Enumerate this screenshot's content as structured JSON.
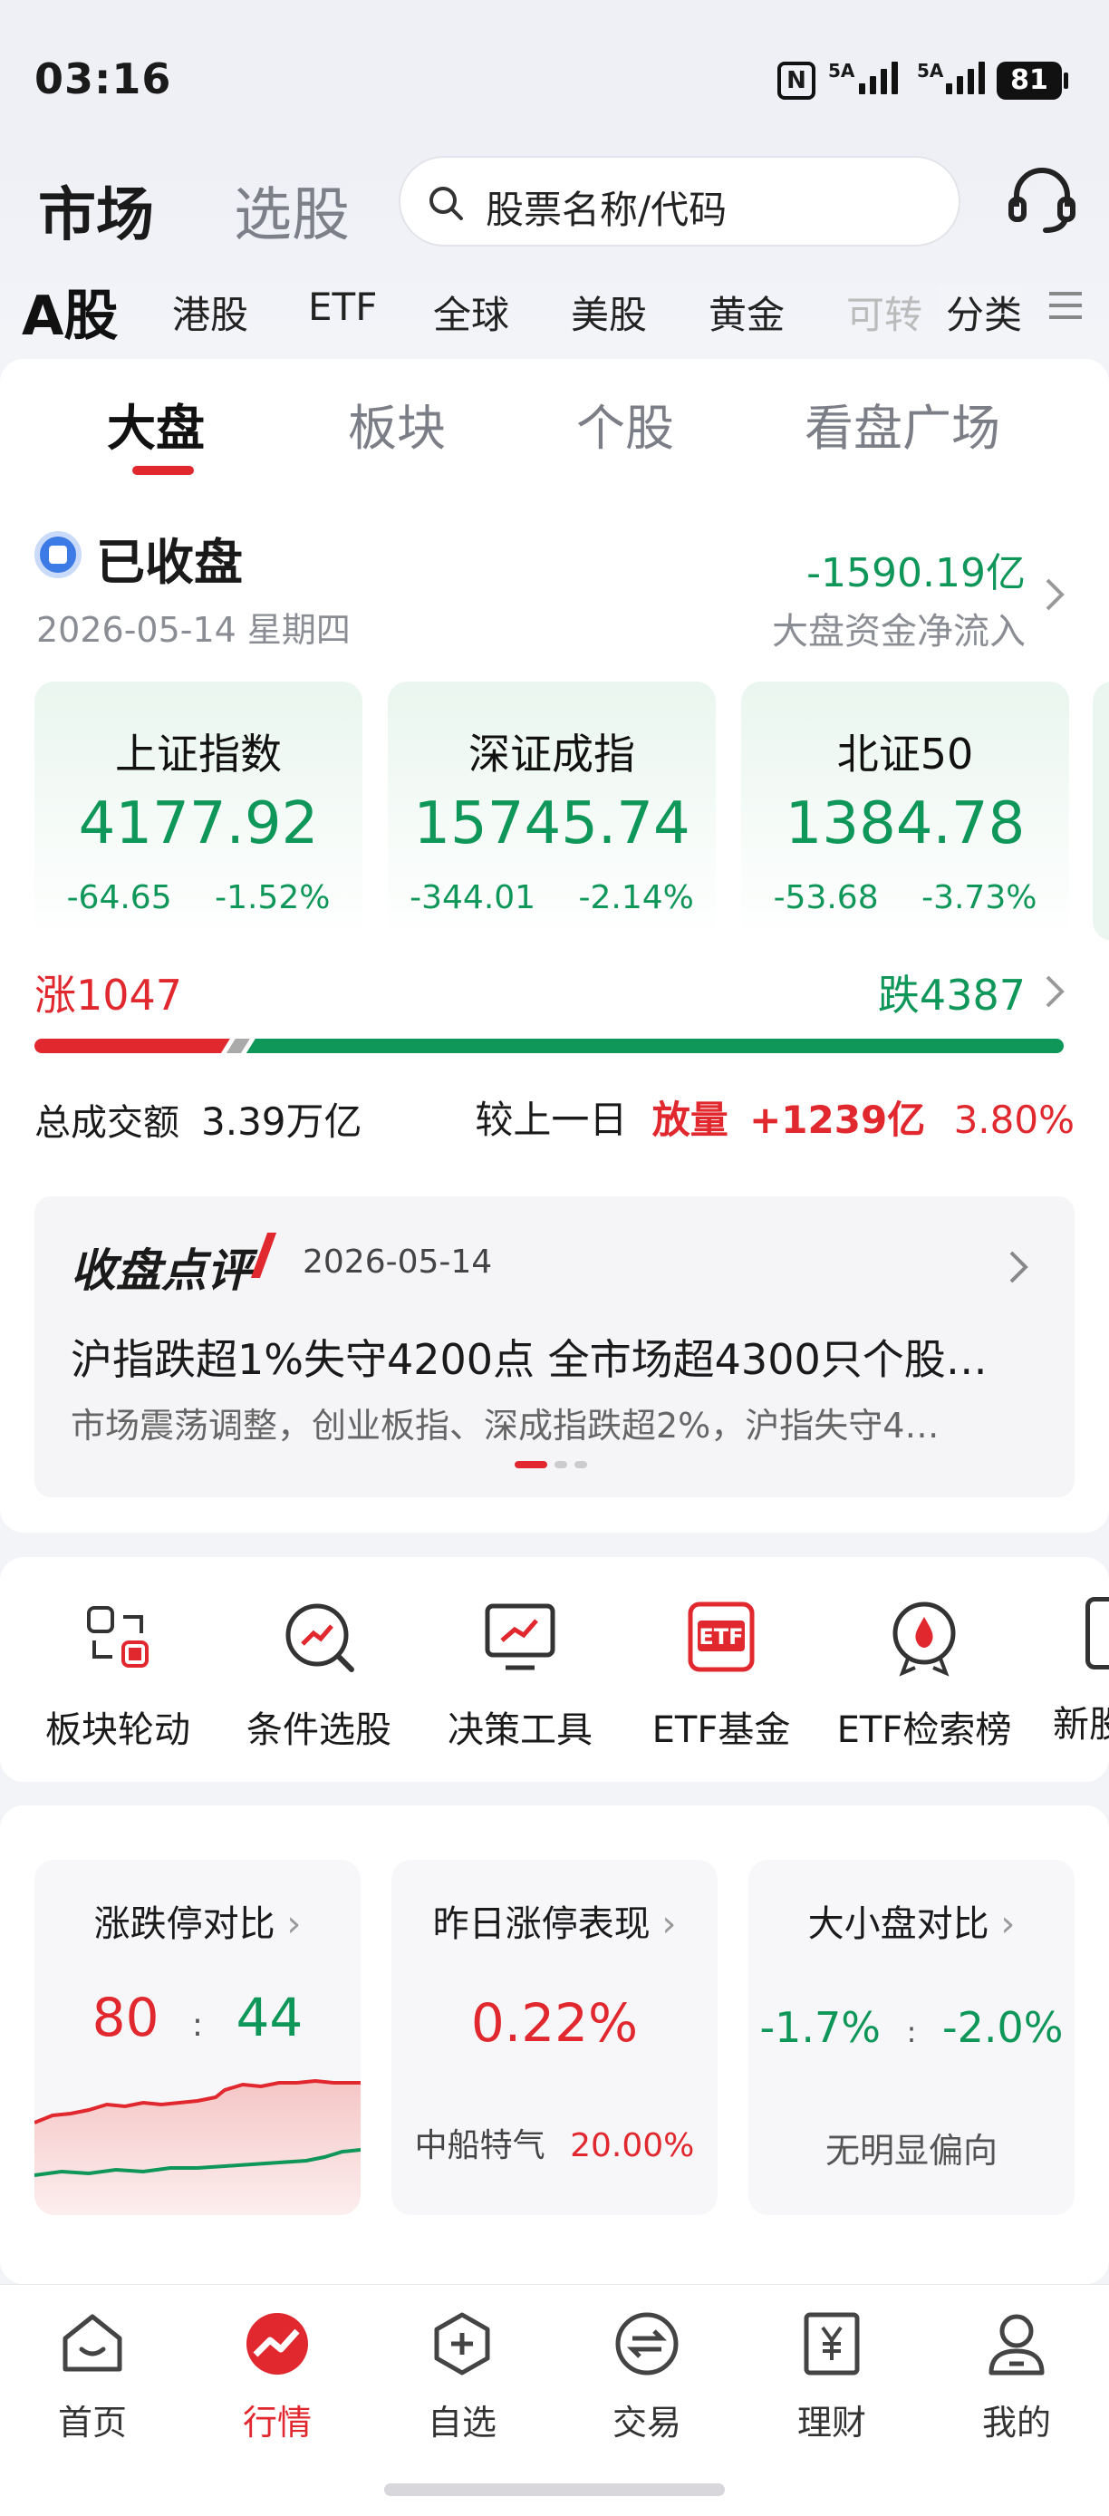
{
  "status_bar": {
    "time": "03:16",
    "nfc_icon": "nfc-icon",
    "sim1": "5A",
    "sim2": "5A",
    "battery": "81"
  },
  "header": {
    "tab_market": "市场",
    "tab_pick": "选股",
    "search_placeholder": "股票名称/代码",
    "service_icon": "headset-icon"
  },
  "market_tabs": [
    "A股",
    "港股",
    "ETF",
    "全球",
    "美股",
    "黄金",
    "可转",
    "分类"
  ],
  "sub_tabs": [
    "大盘",
    "板块",
    "个股",
    "看盘广场"
  ],
  "market_status": {
    "label": "已收盘",
    "date": "2026-05-14 星期四",
    "net_flow": "-1590.19亿",
    "net_flow_label": "大盘资金净流入"
  },
  "indices": [
    {
      "name": "上证指数",
      "value": "4177.92",
      "change": "-64.65",
      "pct": "-1.52%"
    },
    {
      "name": "深证成指",
      "value": "15745.74",
      "change": "-344.01",
      "pct": "-2.14%"
    },
    {
      "name": "北证50",
      "value": "1384.78",
      "change": "-53.68",
      "pct": "-3.73%"
    }
  ],
  "breadth": {
    "up_label": "涨",
    "up": "1047",
    "down_label": "跌",
    "down": "4387",
    "up_ratio": 0.19
  },
  "turnover": {
    "label": "总成交额",
    "value": "3.39万亿",
    "compare_label": "较上一日",
    "tag": "放量",
    "delta": "+1239亿",
    "pct": "3.80%"
  },
  "commentary": {
    "title": "收盘点评",
    "date": "2026-05-14",
    "headline": "沪指跌超1%失守4200点 全市场超4300只个股…",
    "summary": "市场震荡调整，创业板指、深成指跌超2%，沪指失守4…"
  },
  "tools": [
    "板块轮动",
    "条件选股",
    "决策工具",
    "ETF基金",
    "ETF检索榜",
    "新股"
  ],
  "compare_cards": {
    "limit": {
      "title": "涨跌停对比",
      "up": "80",
      "sep": ":",
      "down": "44"
    },
    "yesterday": {
      "title": "昨日涨停表现",
      "value": "0.22%",
      "stock": "中船特气",
      "stock_pct": "20.00%"
    },
    "size": {
      "title": "大小盘对比",
      "big": "-1.7%",
      "sep": ":",
      "small": "-2.0%",
      "note": "无明显偏向"
    }
  },
  "tab_bar": [
    {
      "label": "首页",
      "icon": "home-icon"
    },
    {
      "label": "行情",
      "icon": "market-trend-icon"
    },
    {
      "label": "自选",
      "icon": "add-watchlist-icon"
    },
    {
      "label": "交易",
      "icon": "trade-exchange-icon"
    },
    {
      "label": "理财",
      "icon": "wealth-yen-icon"
    },
    {
      "label": "我的",
      "icon": "profile-icon"
    }
  ],
  "colors": {
    "up": "#e0282e",
    "down": "#0f9659",
    "accent": "#e0282e"
  }
}
